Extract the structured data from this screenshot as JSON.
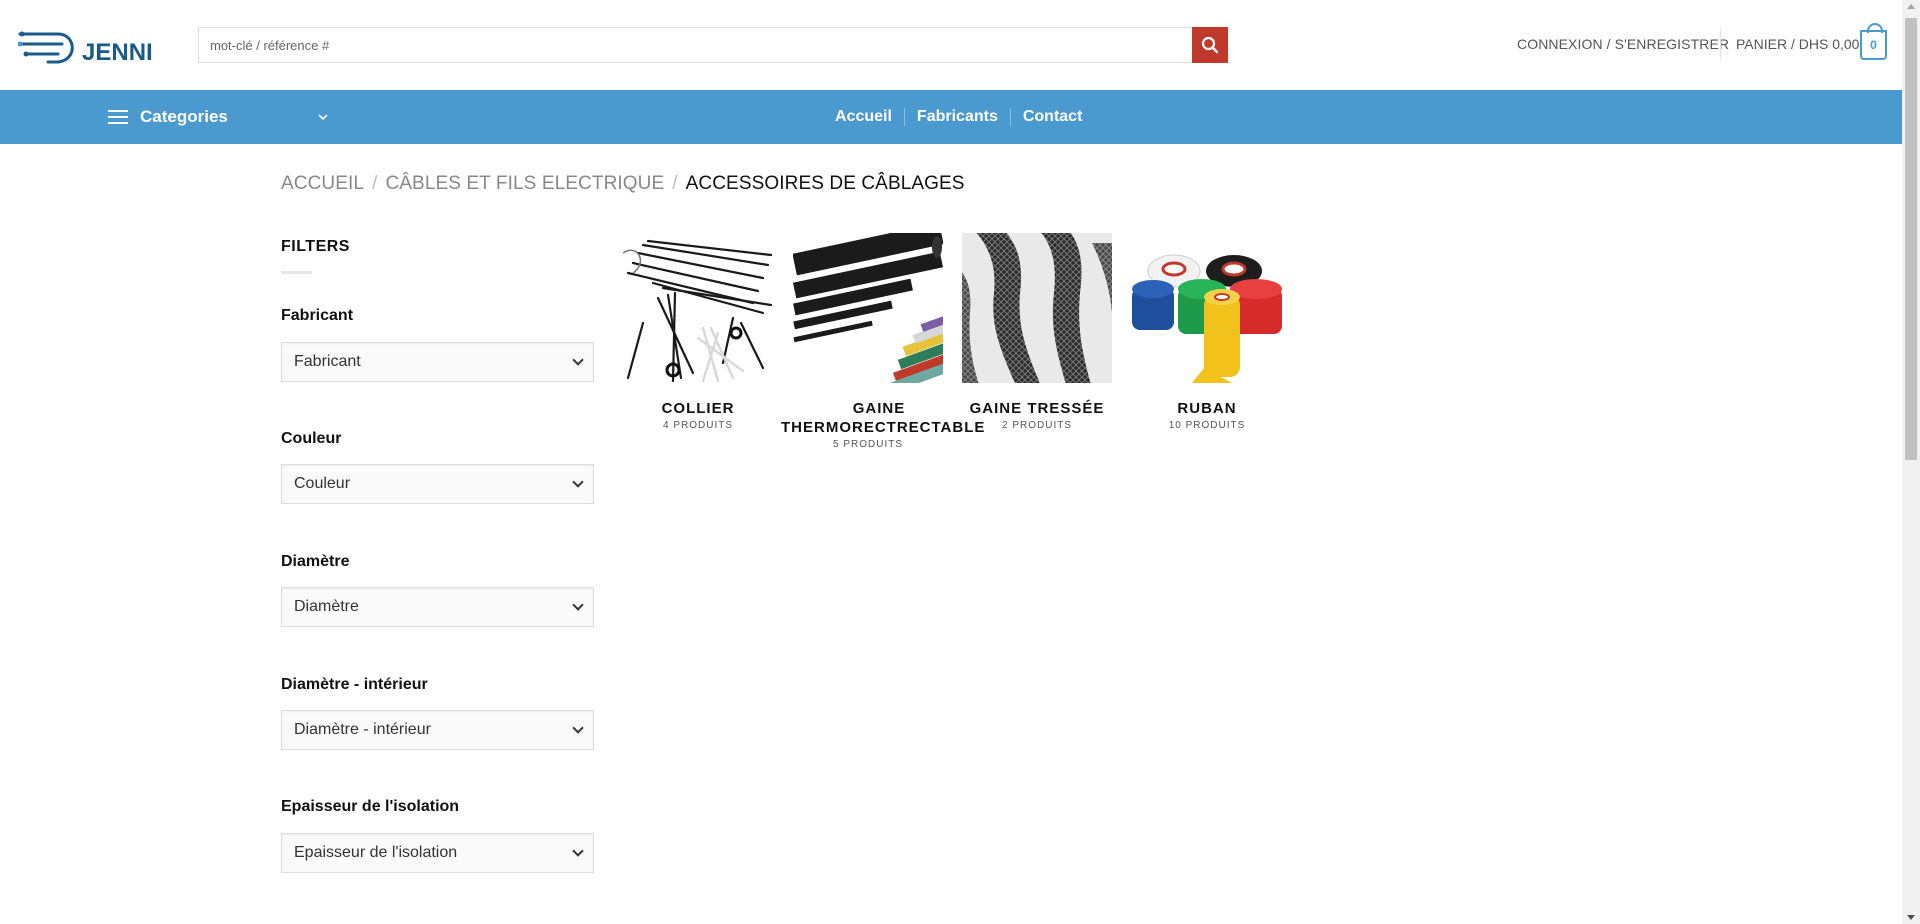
{
  "header": {
    "logo_text": "JENNI",
    "search": {
      "placeholder": "mot-clé / référence #",
      "value": ""
    },
    "account_label": "CONNEXION / S'ENREGISTRER",
    "cart_label": "PANIER / DHS 0,00",
    "cart_count": "0"
  },
  "navbar": {
    "categories_label": "Categories",
    "links": [
      {
        "label": "Accueil"
      },
      {
        "label": "Fabricants"
      },
      {
        "label": "Contact"
      }
    ]
  },
  "breadcrumb": {
    "items": [
      {
        "label": "ACCUEIL"
      },
      {
        "label": "CÂBLES ET FILS ELECTRIQUE"
      }
    ],
    "current": "ACCESSOIRES DE CÂBLAGES",
    "separator": "/"
  },
  "sidebar": {
    "title": "FILTERS",
    "filters": [
      {
        "label": "Fabricant",
        "selected": "Fabricant"
      },
      {
        "label": "Couleur",
        "selected": "Couleur"
      },
      {
        "label": "Diamètre",
        "selected": "Diamètre"
      },
      {
        "label": "Diamètre - intérieur",
        "selected": "Diamètre - intérieur"
      },
      {
        "label": "Epaisseur de l'isolation",
        "selected": "Epaisseur de l'isolation"
      }
    ]
  },
  "categories": [
    {
      "name": "COLLIER",
      "count": "4 PRODUITS",
      "image": "cable-ties"
    },
    {
      "name": "GAINE THERMORECTRECTABLE",
      "count": "5 PRODUITS",
      "image": "heat-shrink-tubing"
    },
    {
      "name": "GAINE TRESSÉE",
      "count": "2 PRODUITS",
      "image": "braided-sleeve"
    },
    {
      "name": "RUBAN",
      "count": "10 PRODUITS",
      "image": "tape-rolls"
    }
  ],
  "colors": {
    "nav_bg": "#4a9ad0",
    "search_button": "#c0392b",
    "brand": "#1a5a8a"
  }
}
